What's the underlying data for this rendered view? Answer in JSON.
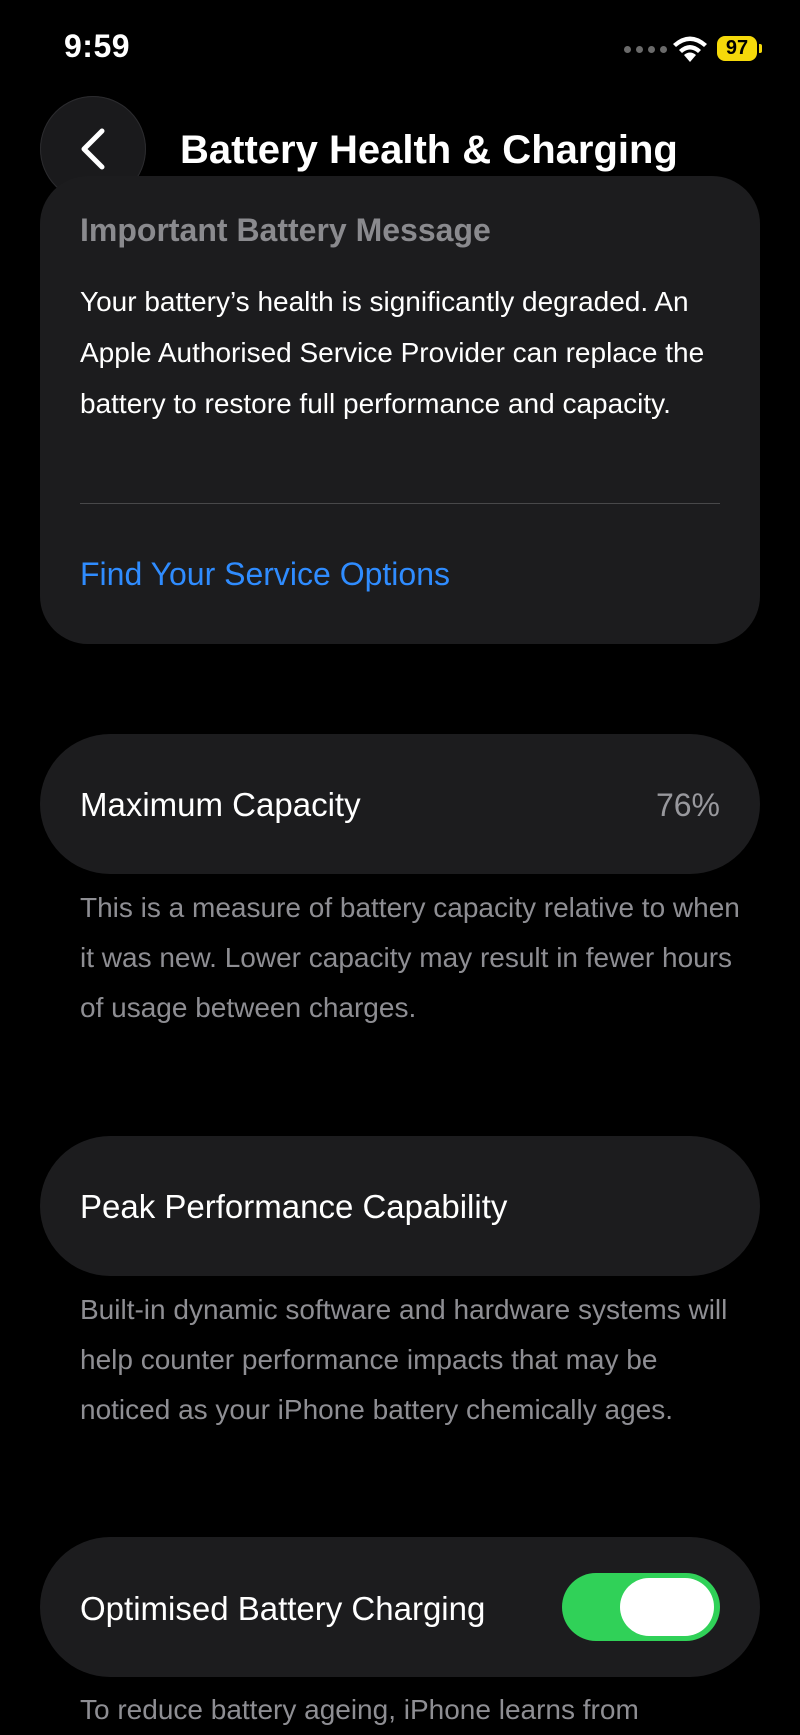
{
  "status_bar": {
    "time": "9:59",
    "battery_level": "97",
    "battery_color": "#f5d90a"
  },
  "header": {
    "back_icon": "chevron-left-icon",
    "title": "Battery Health & Charging"
  },
  "battery_message": {
    "title": "Important Battery Message",
    "body": "Your battery’s health is significantly degraded. An Apple Authorised Service Provider can replace the battery to restore full performance and capacity.",
    "link_label": "Find Your Service Options",
    "link_color": "#2f8cff"
  },
  "maximum_capacity": {
    "label": "Maximum Capacity",
    "value": "76%",
    "footnote": "This is a measure of battery capacity relative to when it was new. Lower capacity may result in fewer hours of usage between charges."
  },
  "peak_performance": {
    "label": "Peak Performance Capability",
    "footnote": "Built-in dynamic software and hardware systems will help counter performance impacts that may be noticed as your iPhone battery chemically ages."
  },
  "optimised_charging": {
    "label": "Optimised Battery Charging",
    "enabled": true,
    "toggle_color": "#30d158",
    "footnote": "To reduce battery ageing, iPhone learns from"
  }
}
